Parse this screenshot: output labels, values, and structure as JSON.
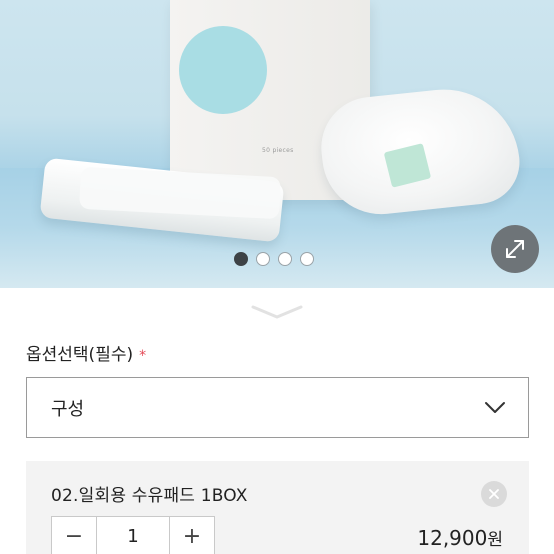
{
  "gallery": {
    "box_text": "50 pieces",
    "slide_count": 4,
    "active_slide": 1,
    "zoom_icon": "expand-arrows-icon"
  },
  "collapse_handle": {
    "icon": "chevron-down-icon"
  },
  "option": {
    "label": "옵션선택(필수)",
    "required_mark": "*",
    "required_color": "#e44a57",
    "select_value": "구성",
    "select_icon": "chevron-down-icon"
  },
  "selected_item": {
    "name": "02.일회용 수유패드 1BOX",
    "quantity": "1",
    "minus_label": "−",
    "plus_label": "+",
    "price": "12,900",
    "currency": "원",
    "remove_icon": "close-icon"
  }
}
